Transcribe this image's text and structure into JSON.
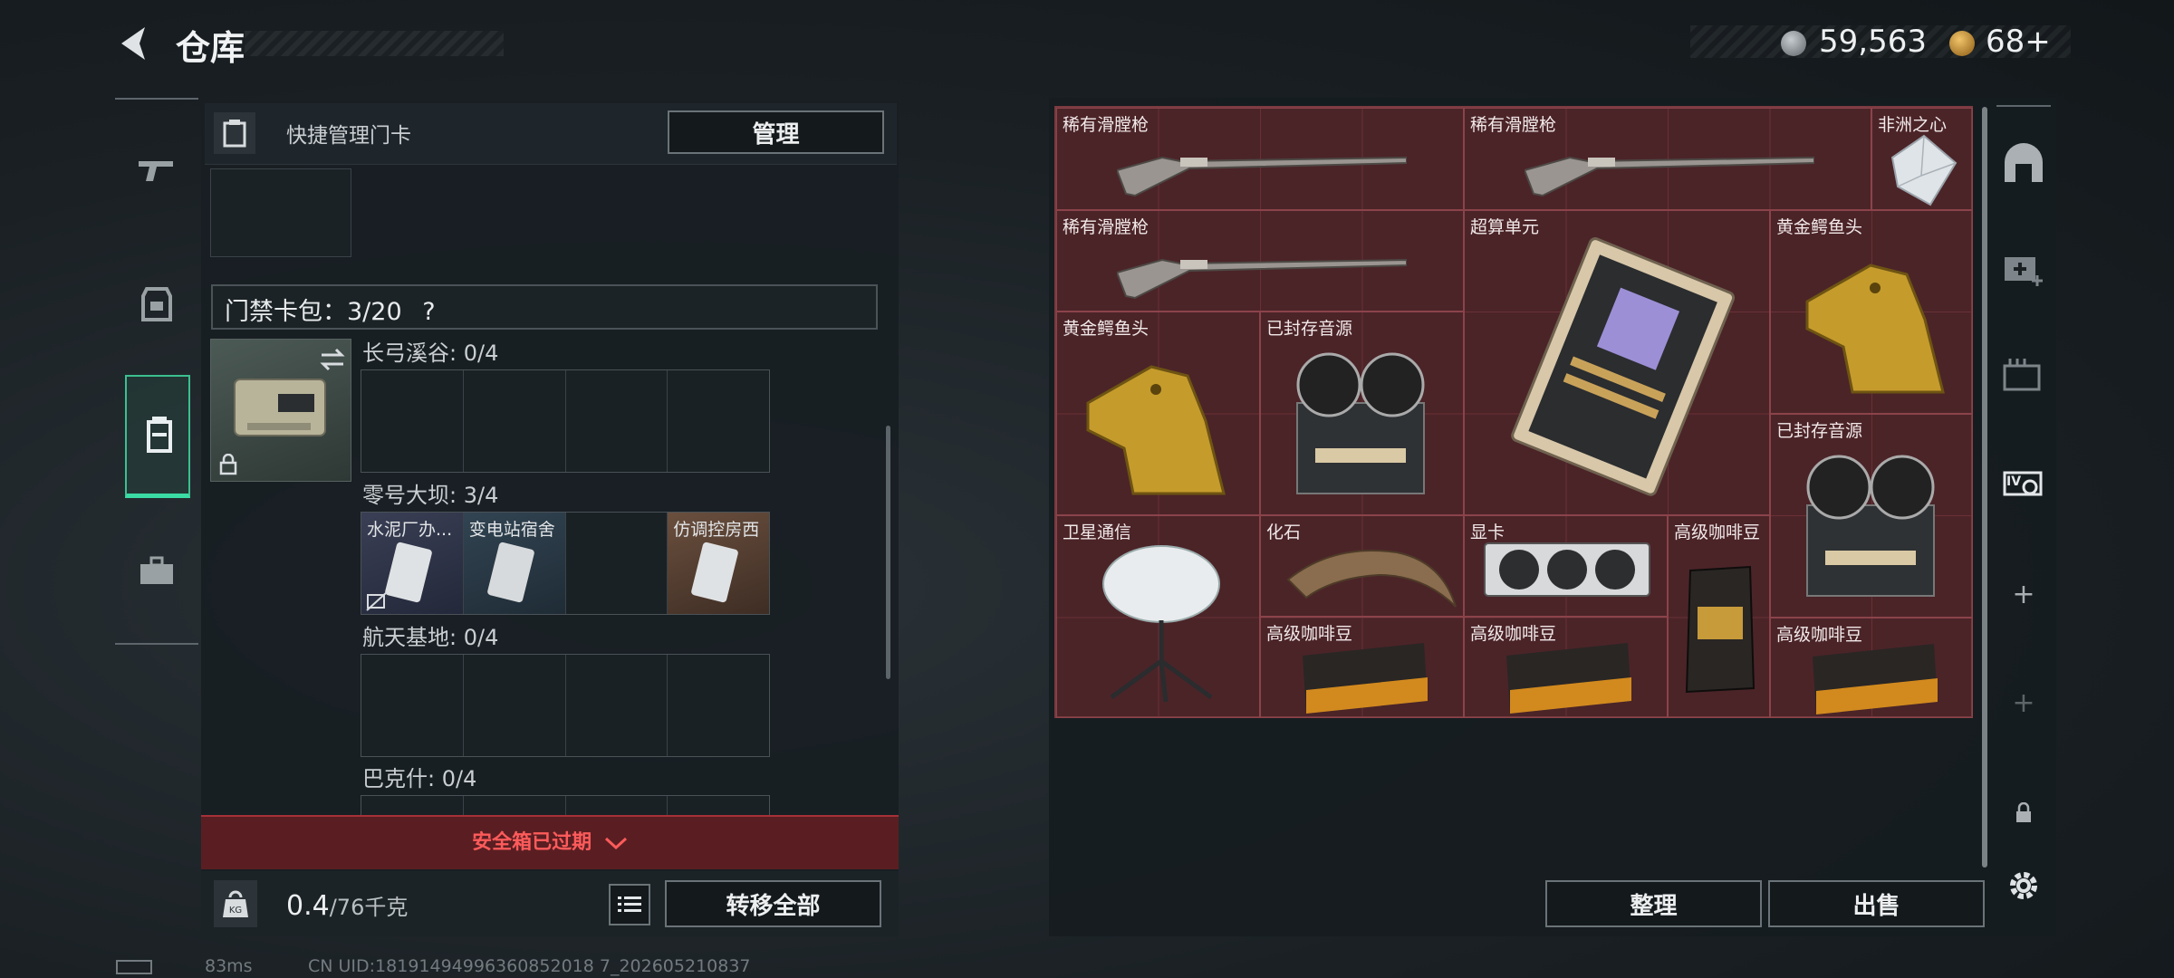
{
  "header": {
    "title": "仓库",
    "currency_amount": "59,563",
    "ticket_amount": "68",
    "ticket_add": "+"
  },
  "left_panel": {
    "card_manage_label": "快捷管理门卡",
    "manage_button": "管理",
    "card_pack": "门禁卡包：3/20",
    "card_pack_help": "?",
    "areas": [
      {
        "name": "长弓溪谷: 0/4",
        "slots": [
          "",
          "",
          "",
          ""
        ]
      },
      {
        "name": "零号大坝: 3/4",
        "slots": [
          "水泥厂办...",
          "变电站宿舍",
          "",
          "仿调控房西"
        ]
      },
      {
        "name": "航天基地: 0/4",
        "slots": [
          "",
          "",
          "",
          ""
        ]
      },
      {
        "name": "巴克什: 0/4",
        "slots": [
          "",
          "",
          "",
          ""
        ]
      }
    ],
    "safe_box_status": "安全箱已过期",
    "weight_current": "0.4",
    "weight_max": "/76千克",
    "transfer_all_button": "转移全部"
  },
  "stash": {
    "items": [
      {
        "label": "稀有滑膛枪"
      },
      {
        "label": "稀有滑膛枪"
      },
      {
        "label": "非洲之心"
      },
      {
        "label": "稀有滑膛枪"
      },
      {
        "label": "超算单元"
      },
      {
        "label": "黄金鳄鱼头"
      },
      {
        "label": "黄金鳄鱼头"
      },
      {
        "label": "已封存音源"
      },
      {
        "label": "已封存音源"
      },
      {
        "label": "卫星通信"
      },
      {
        "label": "化石"
      },
      {
        "label": "显卡"
      },
      {
        "label": "高级咖啡豆"
      },
      {
        "label": "高级咖啡豆"
      },
      {
        "label": "高级咖啡豆"
      },
      {
        "label": "高级咖啡豆"
      }
    ],
    "sort_button": "整理",
    "sell_button": "出售"
  },
  "footer": {
    "ping": "83ms",
    "uid": "CN UID:18191494996360852018 7_202605210837"
  },
  "colors": {
    "stash_bg": "#4b2428",
    "accent_green": "#3bdba4",
    "warning_red": "#ff5b5b"
  }
}
